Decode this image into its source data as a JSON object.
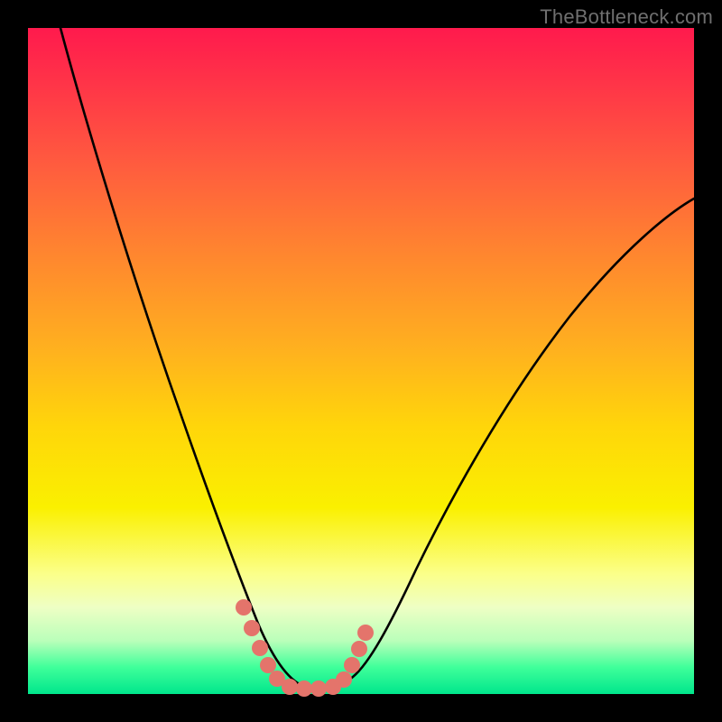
{
  "watermark": "TheBottleneck.com",
  "chart_data": {
    "type": "line",
    "title": "",
    "xlabel": "",
    "ylabel": "",
    "xlim": [
      0,
      100
    ],
    "ylim": [
      0,
      100
    ],
    "series": [
      {
        "name": "bottleneck-curve",
        "x": [
          5,
          10,
          15,
          20,
          25,
          30,
          33,
          36,
          39,
          42,
          45,
          48,
          52,
          58,
          65,
          72,
          80,
          88,
          95,
          100
        ],
        "y": [
          100,
          83,
          67,
          52,
          38,
          24,
          14,
          7,
          2.5,
          0.5,
          0.5,
          1.5,
          4,
          10,
          20,
          31,
          44,
          56,
          65,
          71
        ]
      }
    ],
    "highlight": {
      "name": "optimal-range",
      "x": [
        33.5,
        35,
        37,
        39,
        41,
        43,
        45,
        46.8,
        48.5
      ],
      "y": [
        11.5,
        6.5,
        3,
        1.3,
        0.6,
        0.6,
        1.2,
        3.5,
        8.5
      ]
    },
    "gradient_stops": [
      {
        "pos": 0,
        "color": "#ff1a4d"
      },
      {
        "pos": 60,
        "color": "#ffd60a"
      },
      {
        "pos": 100,
        "color": "#00e68c"
      }
    ]
  }
}
